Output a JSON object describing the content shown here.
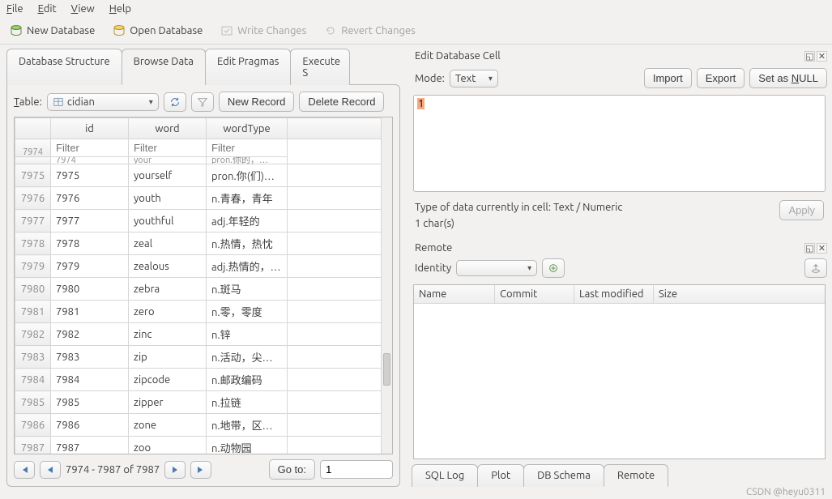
{
  "menu": {
    "file": "File",
    "edit": "Edit",
    "view": "View",
    "help": "Help"
  },
  "toolbar": {
    "new_db": "New Database",
    "open_db": "Open Database",
    "write_changes": "Write Changes",
    "revert_changes": "Revert Changes"
  },
  "left_tabs": {
    "structure": "Database Structure",
    "browse": "Browse Data",
    "pragmas": "Edit Pragmas",
    "execute": "Execute S"
  },
  "browse": {
    "table_label": "Table:",
    "table_name": "cidian",
    "new_record": "New Record",
    "delete_record": "Delete Record",
    "columns": {
      "id": "id",
      "word": "word",
      "wordType": "wordType"
    },
    "filter_placeholder": "Filter",
    "partial_row": {
      "rownum": "7974",
      "id": "7974",
      "word": "your",
      "wordType": "pron.你的，…"
    },
    "rows": [
      {
        "rownum": "7975",
        "id": "7975",
        "word": "yourself",
        "wordType": "pron.你(们)…"
      },
      {
        "rownum": "7976",
        "id": "7976",
        "word": "youth",
        "wordType": "n.青春，青年"
      },
      {
        "rownum": "7977",
        "id": "7977",
        "word": "youthful",
        "wordType": "adj.年轻的"
      },
      {
        "rownum": "7978",
        "id": "7978",
        "word": "zeal",
        "wordType": "n.热情，热忱"
      },
      {
        "rownum": "7979",
        "id": "7979",
        "word": "zealous",
        "wordType": "adj.热情的，…"
      },
      {
        "rownum": "7980",
        "id": "7980",
        "word": "zebra",
        "wordType": "n.斑马"
      },
      {
        "rownum": "7981",
        "id": "7981",
        "word": "zero",
        "wordType": "n.零，零度"
      },
      {
        "rownum": "7982",
        "id": "7982",
        "word": "zinc",
        "wordType": "n.锌"
      },
      {
        "rownum": "7983",
        "id": "7983",
        "word": "zip",
        "wordType": "n.活动，尖啸声"
      },
      {
        "rownum": "7984",
        "id": "7984",
        "word": "zipcode",
        "wordType": "n.邮政编码"
      },
      {
        "rownum": "7985",
        "id": "7985",
        "word": "zipper",
        "wordType": "n.拉链"
      },
      {
        "rownum": "7986",
        "id": "7986",
        "word": "zone",
        "wordType": "n.地带，区域…"
      },
      {
        "rownum": "7987",
        "id": "7987",
        "word": "zoo",
        "wordType": "n.动物园"
      }
    ],
    "pager": {
      "range": "7974 - 7987 of 7987",
      "goto": "Go to:",
      "page": "1"
    }
  },
  "cell_editor": {
    "title": "Edit Database Cell",
    "mode_label": "Mode:",
    "mode_value": "Text",
    "import": "Import",
    "export": "Export",
    "set_null": "Set as NULL",
    "content": "1",
    "type_info": "Type of data currently in cell: Text / Numeric",
    "size_info": "1 char(s)",
    "apply": "Apply"
  },
  "remote": {
    "title": "Remote",
    "identity_label": "Identity",
    "cols": {
      "name": "Name",
      "commit": "Commit",
      "last_modified": "Last modified",
      "size": "Size"
    }
  },
  "bottom_tabs": {
    "sql_log": "SQL Log",
    "plot": "Plot",
    "db_schema": "DB Schema",
    "remote": "Remote"
  },
  "watermark": "CSDN @heyu0311"
}
